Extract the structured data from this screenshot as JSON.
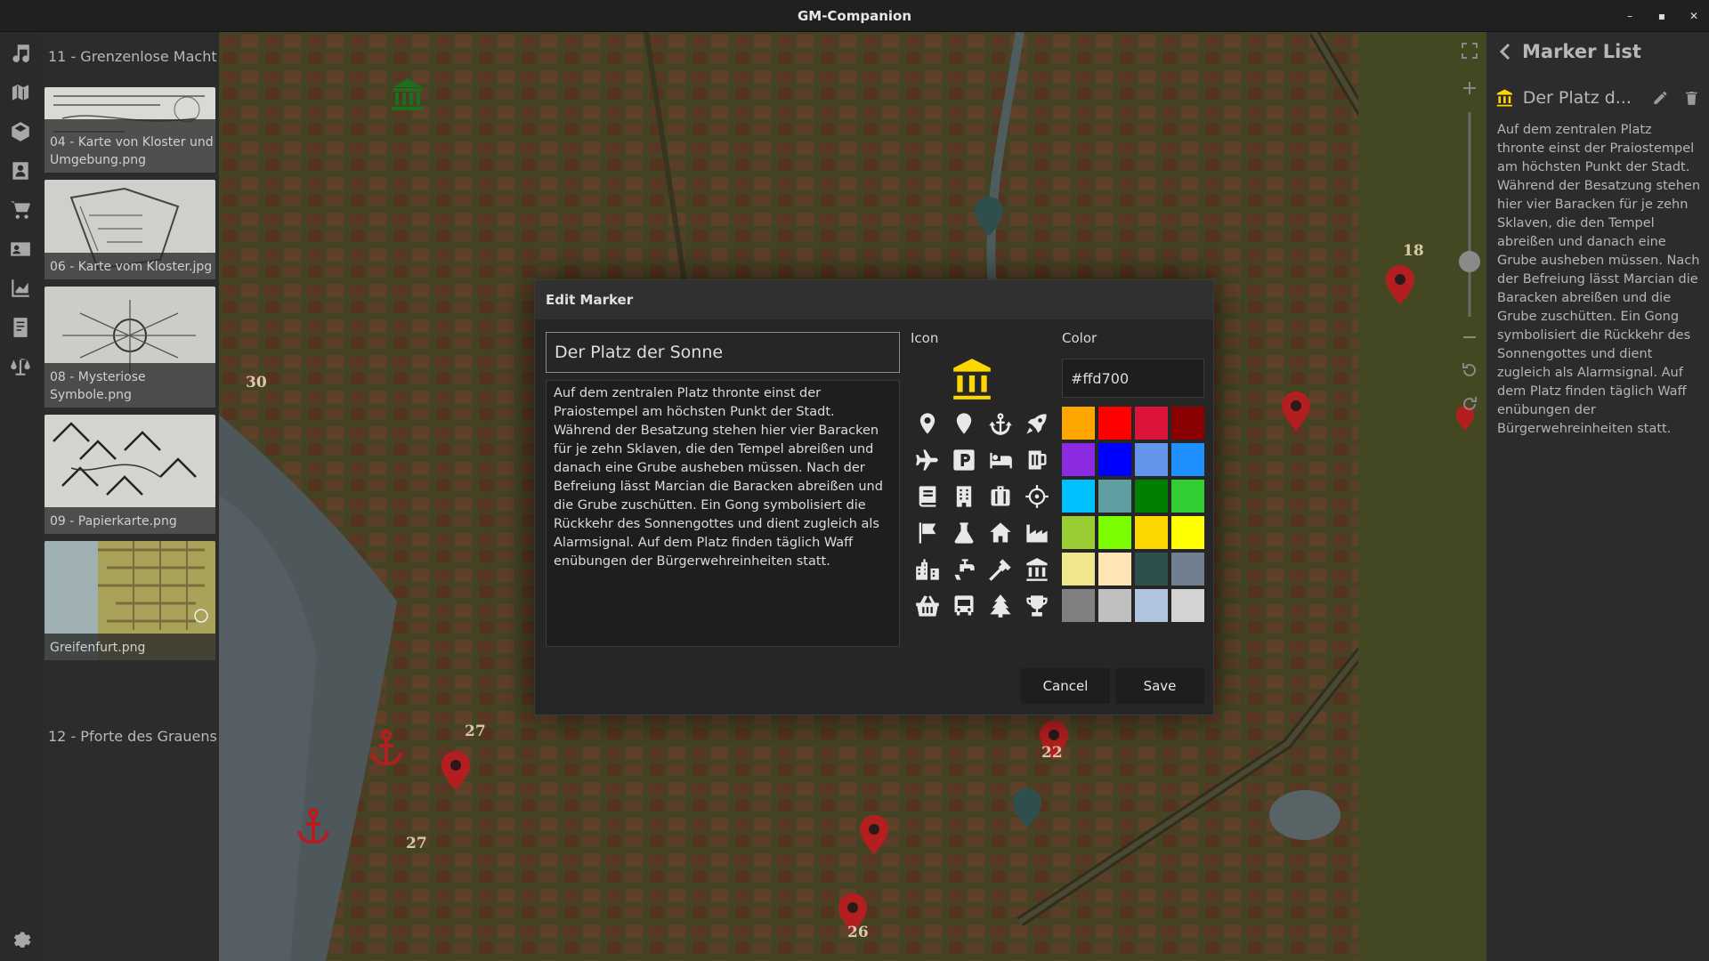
{
  "window": {
    "title": "GM-Companion",
    "controls": {
      "minimize": "–",
      "maximize": "▪",
      "close": "✕"
    }
  },
  "sidebar": {
    "icons": [
      "music-icon",
      "map-icon",
      "dice-icon",
      "character-icon",
      "cart-icon",
      "contact-card-icon",
      "chart-icon",
      "notes-icon",
      "balance-scale-icon"
    ],
    "settings_icon": "gear-icon"
  },
  "file_panel": {
    "folder_top": "11 - Grenzenlose Macht",
    "maps": [
      {
        "label": "04 - Karte von Kloster und Umgebung.png"
      },
      {
        "label": "06 - Karte vom Kloster.jpg"
      },
      {
        "label": "08 - Mysteriose Symbole.png"
      },
      {
        "label": "09 - Papierkarte.png"
      },
      {
        "label": "Greifenfurt.png"
      }
    ],
    "folder_bottom": "12 - Pforte des Grauens"
  },
  "map": {
    "labels": [
      "18",
      "30",
      "27",
      "27",
      "26",
      "22"
    ]
  },
  "marker_list": {
    "title": "Marker List",
    "item": {
      "name": "Der Platz d...",
      "icon": "landmark-icon",
      "icon_color": "#ffd700"
    },
    "description": "Auf dem zentralen Platz thronte einst der Praiostempel am höchsten Punkt der Stadt. Während der Besatzung stehen hier vier Baracken für je zehn Sklaven, die den Tempel abreißen und danach eine Grube ausheben müssen. Nach der Befreiung lässt Marcian die Baracken abreißen und die Grube zuschütten. Ein Gong symbolisiert die Rückkehr des Sonnengottes und dient zugleich als Alarmsignal. Auf dem Platz finden täglich Waff enübungen der Bürgerwehreinheiten statt."
  },
  "dialog": {
    "title": "Edit Marker",
    "name_value": "Der Platz der Sonne",
    "description_value": "Auf dem zentralen Platz thronte einst der Praiostempel am höchsten Punkt der Stadt. Während der Besatzung stehen hier vier Baracken für je zehn Sklaven, die den Tempel abreißen und danach eine Grube ausheben müssen. Nach der Befreiung lässt Marcian die Baracken abreißen und die Grube zuschütten. Ein Gong symbolisiert die Rückkehr des Sonnengottes und dient zugleich als Alarmsignal. Auf dem Platz finden täglich Waff enübungen der Bürgerwehreinheiten statt.",
    "icon_label": "Icon",
    "color_label": "Color",
    "selected_icon": "landmark-icon",
    "color_value": "#ffd700",
    "color_input_text": "#ffd700",
    "icons": [
      "map-marker-icon",
      "map-pin-icon",
      "anchor-icon",
      "rocket-icon",
      "plane-icon",
      "parking-icon",
      "bed-icon",
      "beer-icon",
      "book-icon",
      "building-icon",
      "suitcase-icon",
      "crosshairs-icon",
      "flag-icon",
      "flask-icon",
      "home-icon",
      "industry-icon",
      "city-icon",
      "faucet-icon",
      "hammer-icon",
      "landmark-icon",
      "shopping-basket-icon",
      "bus-icon",
      "tree-icon",
      "trophy-icon"
    ],
    "swatches": [
      "#ffa500",
      "#ff0000",
      "#dc143c",
      "#8b0000",
      "#8a2be2",
      "#0000ff",
      "#6495ed",
      "#1e90ff",
      "#00bfff",
      "#5f9ea0",
      "#008000",
      "#32cd32",
      "#9acd32",
      "#7cfc00",
      "#ffd700",
      "#ffff00",
      "#f0e68c",
      "#ffe4b5",
      "#2f4f4f",
      "#708090",
      "#808080",
      "#c0c0c0",
      "#b0c4de",
      "#d3d3d3"
    ],
    "cancel_label": "Cancel",
    "save_label": "Save"
  }
}
